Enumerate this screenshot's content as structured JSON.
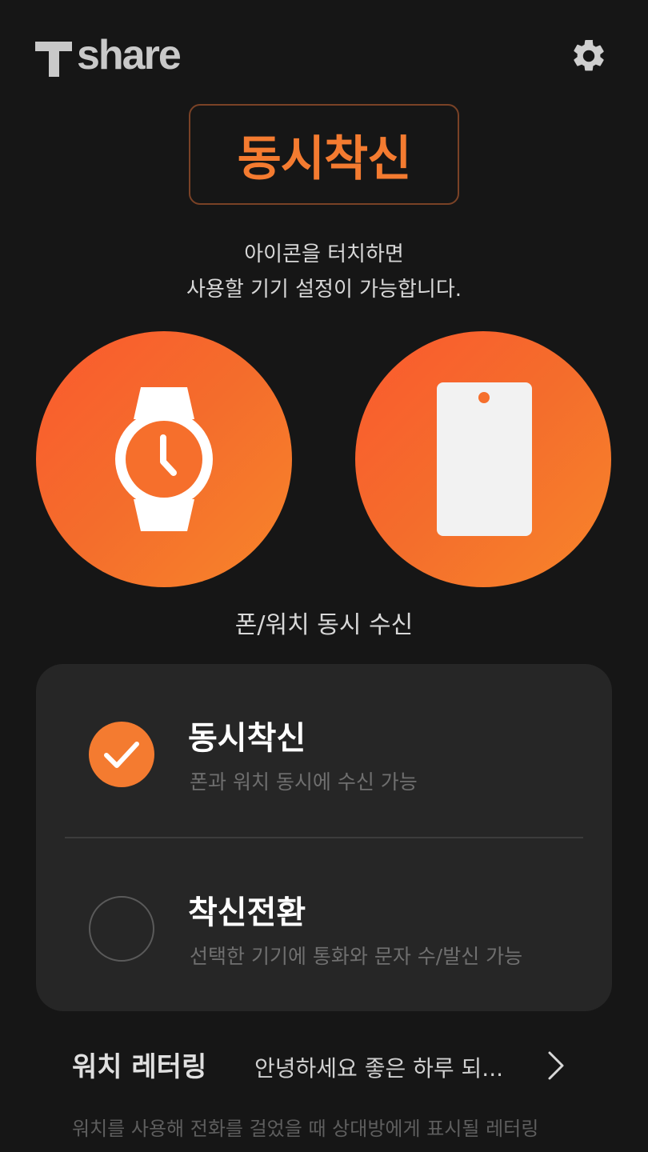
{
  "header": {
    "logo_text": "share",
    "logo_icon": "t-logo-icon",
    "settings_icon": "gear-icon"
  },
  "mode": {
    "title": "동시착신"
  },
  "guide": {
    "line1": "아이콘을 터치하면",
    "line2": "사용할 기기 설정이 가능합니다."
  },
  "devices": {
    "watch_icon": "smartwatch-icon",
    "phone_icon": "phone-icon",
    "caption": "폰/워치 동시 수신"
  },
  "options": [
    {
      "title": "동시착신",
      "description": "폰과 워치 동시에 수신 가능",
      "selected": true
    },
    {
      "title": "착신전환",
      "description": "선택한 기기에 통화와 문자 수/발신 가능",
      "selected": false
    }
  ],
  "lettering": {
    "label": "워치 레터링",
    "value": "안녕하세요 좋은 하루 되...",
    "note": "워치를 사용해 전화를 걸었을 때 상대방에게 표시될 레터링"
  },
  "colors": {
    "accent": "#f47b30",
    "background": "#161616",
    "card": "#262626"
  }
}
